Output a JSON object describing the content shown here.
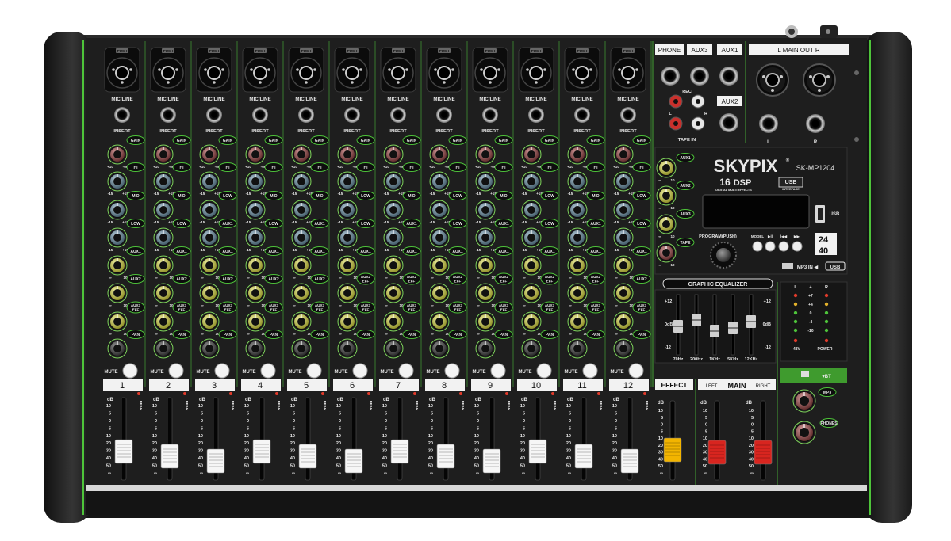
{
  "brand": {
    "name": "SKYPIX",
    "reg": "®",
    "model": "SK-MP1204"
  },
  "dsp": {
    "num": "16",
    "label": "DSP",
    "sub": "DIGITAL MULTI EFFECTS",
    "usb": "USB",
    "usb_sub": "INTERFACE"
  },
  "labels": {
    "push": "PUSH",
    "mic_line": "MIC/LINE",
    "insert": "INSERT",
    "mute": "MUTE",
    "db": "dB",
    "peak": "PEAK",
    "gain_scale_low": "+10",
    "gain_scale_high": "-60",
    "eq_scale_low": "-15",
    "eq_scale_high": "+15",
    "send_scale_low": "∞",
    "send_scale_high": "10"
  },
  "channel_numbers": [
    "1",
    "2",
    "3",
    "4",
    "5",
    "6",
    "7",
    "8",
    "9",
    "10",
    "11",
    "12"
  ],
  "knob_rows": [
    [
      "GAIN",
      "GAIN",
      "GAIN",
      "GAIN",
      "GAIN",
      "GAIN",
      "GAIN",
      "GAIN",
      "GAIN",
      "GAIN",
      "GAIN",
      "GAIN"
    ],
    [
      "HI",
      "HI",
      "HI",
      "HI",
      "HI",
      "HI",
      "HI",
      "HI",
      "HI",
      "HI",
      "HI",
      "HI"
    ],
    [
      "MID",
      "MID",
      "LOW",
      "MID",
      "MID",
      "LOW",
      "MID",
      "LOW",
      "MID",
      "LOW",
      "MID",
      "LOW"
    ],
    [
      "LOW",
      "LOW",
      "AUX1",
      "LOW",
      "AUX1",
      "LOW",
      "AUX1",
      "LOW",
      "AUX1",
      "LOW",
      "AUX1",
      "LOW"
    ],
    [
      "AUX1",
      "AUX1",
      "AUX1",
      "AUX1",
      "AUX1",
      "AUX1",
      "AUX1",
      "AUX1",
      "AUX1",
      "AUX1",
      "AUX1",
      "AUX1"
    ],
    [
      "AUX2",
      "AUX2",
      "AUX2",
      "AUX2",
      "AUX2",
      "AUX2 EFF",
      "AUX2 EFF",
      "AUX2 EFF",
      "AUX2 EFF",
      "AUX2 EFF",
      "AUX2 EFF",
      "AUX2"
    ],
    [
      "AUX3 EFF",
      "AUX3 EFF",
      "AUX3 EFF",
      "AUX3 EFF",
      "AUX3 EFF",
      "AUX3 EFF",
      "AUX3 EFF",
      "AUX3 EFF",
      "AUX3 EFF",
      "AUX3 EFF",
      "AUX3 EFF",
      "AUX3 EFF"
    ],
    [
      "PAN",
      "PAN",
      "PAN",
      "PAN",
      "PAN",
      "PAN",
      "PAN",
      "PAN",
      "PAN",
      "PAN",
      "PAN",
      "PAN"
    ]
  ],
  "fader_scale": [
    "10",
    "5",
    "0",
    "5",
    "10",
    "20",
    "30",
    "40",
    "50",
    "∞"
  ],
  "io": {
    "phone": "PHONE",
    "aux3": "AUX3",
    "aux1": "AUX1",
    "aux2": "AUX2",
    "main_out": "L   MAIN OUT   R",
    "rec": "REC",
    "tape_in": "TAPE IN",
    "l": "L",
    "r": "R"
  },
  "master_knobs": [
    "AUX1",
    "AUX2",
    "AUX3",
    "TAPE"
  ],
  "player": {
    "usb": "USB",
    "program": "PROGRAM(PUSH)",
    "model": "MODEL",
    "play": "▶||",
    "prev": "|◀◀",
    "next": "▶▶|",
    "bit24": "24",
    "bit40": "40",
    "mp3_in": "MP3 IN ◀",
    "mp3_usb": "USB"
  },
  "geq": {
    "title": "GRAPHIC EQUALIZER",
    "bands": [
      "70Hz",
      "200Hz",
      "1KHz",
      "5KHz",
      "12KHz"
    ],
    "scale": [
      "+12",
      "0dB",
      "-12"
    ]
  },
  "meter": {
    "l": "L",
    "plus": "+",
    "r": "R",
    "scale": [
      "+7",
      "+4",
      "0",
      "-4",
      "-10"
    ],
    "p48": "+48V",
    "power": "POWER"
  },
  "mp3": {
    "button": "♥BT",
    "mp3": "MP3",
    "phones": "PHONES"
  },
  "effect": "EFFECT",
  "main": {
    "left": "LEFT",
    "main": "MAIN",
    "right": "RIGHT"
  }
}
